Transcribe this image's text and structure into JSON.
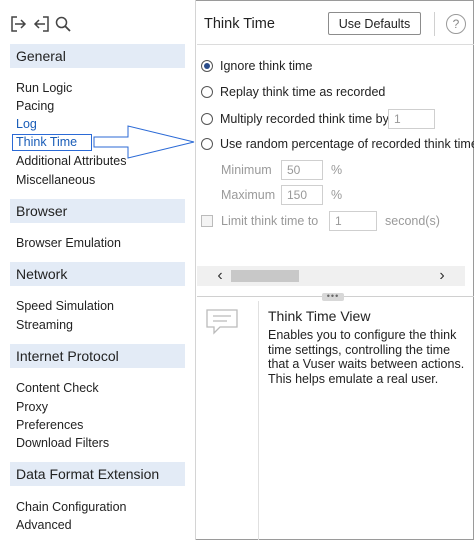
{
  "sidebar": {
    "toolbar_icons": [
      "import-icon",
      "export-icon",
      "search-icon"
    ],
    "sections": [
      {
        "header": "General",
        "items": [
          "Run Logic",
          "Pacing",
          "Log",
          "Think Time",
          "Additional Attributes",
          "Miscellaneous"
        ]
      },
      {
        "header": "Browser",
        "items": [
          "Browser Emulation"
        ]
      },
      {
        "header": "Network",
        "items": [
          "Speed Simulation",
          "Streaming"
        ]
      },
      {
        "header": "Internet Protocol",
        "items": [
          "Content Check",
          "Proxy",
          "Preferences",
          "Download Filters"
        ]
      },
      {
        "header": "Data Format Extension",
        "items": [
          "Chain Configuration",
          "Advanced"
        ]
      }
    ],
    "selected_item": "Think Time"
  },
  "panel": {
    "title": "Think Time",
    "use_defaults_label": "Use Defaults",
    "help_symbol": "?",
    "options": {
      "ignore": "Ignore think time",
      "replay": "Replay think time as recorded",
      "multiply": "Multiply recorded think time by",
      "random": "Use random percentage of recorded think time"
    },
    "selected_option": "ignore",
    "multiply_value": "1",
    "minimum_label": "Minimum",
    "minimum_value": "50",
    "maximum_label": "Maximum",
    "maximum_value": "150",
    "percent_sign": "%",
    "limit_label": "Limit think time to",
    "limit_value": "1",
    "limit_unit": "second(s)",
    "limit_checked": false,
    "scroll_left": "‹",
    "scroll_right": "›"
  },
  "info": {
    "title": "Think Time View",
    "body": "Enables you to configure the think time settings, controlling the time that a Vuser waits between actions. This helps emulate a real user."
  },
  "colors": {
    "section_header_bg": "#e3ebf6",
    "selected_text": "#1a5db8",
    "arrow": "#2b6ad6"
  }
}
